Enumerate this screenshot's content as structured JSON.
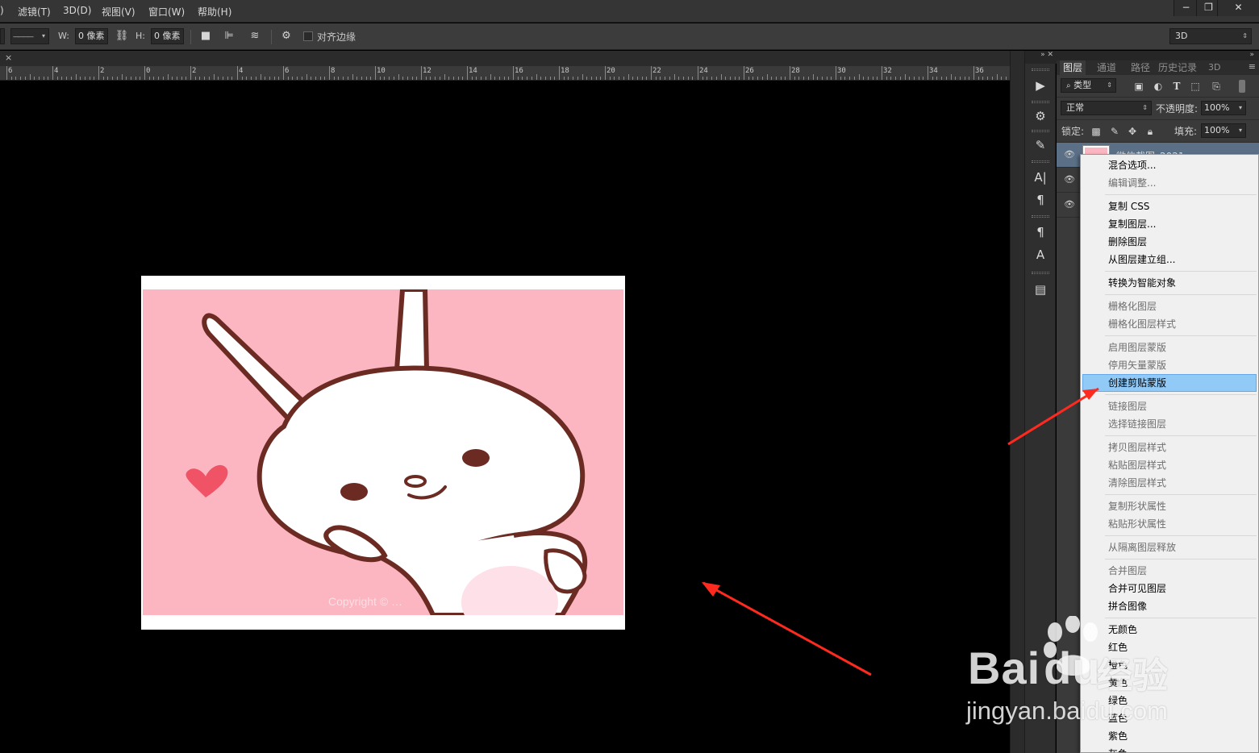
{
  "menubar": {
    "items": [
      "滤镜(T)",
      "3D(D)",
      "视图(V)",
      "窗口(W)",
      "帮助(H)"
    ],
    "partial_left": ")",
    "window_controls": [
      "−",
      "❐",
      "✕"
    ]
  },
  "options": {
    "stroke_style": "————",
    "w_label": "W:",
    "w_value": "0 像素",
    "link_icon": "link-icon",
    "h_label": "H:",
    "h_value": "0 像素",
    "align_edges_label": "对齐边缘",
    "workspace": "3D"
  },
  "doc": {
    "close": "×",
    "ruler_labels": [
      "6",
      "4",
      "2",
      "0",
      "2",
      "4",
      "6",
      "8",
      "10",
      "12",
      "14",
      "16",
      "18",
      "20",
      "22",
      "24",
      "26",
      "28",
      "30",
      "32",
      "34",
      "36"
    ]
  },
  "layers_panel": {
    "tabs": [
      "图层",
      "通道",
      "路径",
      "历史记录",
      "3D"
    ],
    "filter_kind": "类型",
    "blend_mode": "正常",
    "opacity_label": "不透明度:",
    "opacity_value": "100%",
    "lock_label": "锁定:",
    "fill_label": "填充:",
    "fill_value": "100%",
    "layer_name_partial": "微信截图_2021..."
  },
  "context_menu": {
    "groups": [
      [
        {
          "label": "混合选项...",
          "enabled": true
        },
        {
          "label": "编辑调整...",
          "enabled": false
        }
      ],
      [
        {
          "label": "复制 CSS",
          "enabled": true
        },
        {
          "label": "复制图层...",
          "enabled": true
        },
        {
          "label": "删除图层",
          "enabled": true
        },
        {
          "label": "从图层建立组...",
          "enabled": true
        }
      ],
      [
        {
          "label": "转换为智能对象",
          "enabled": true
        }
      ],
      [
        {
          "label": "栅格化图层",
          "enabled": false
        },
        {
          "label": "栅格化图层样式",
          "enabled": false
        }
      ],
      [
        {
          "label": "启用图层蒙版",
          "enabled": false
        },
        {
          "label": "停用矢量蒙版",
          "enabled": false
        },
        {
          "label": "创建剪贴蒙版",
          "enabled": true,
          "highlighted": true
        }
      ],
      [
        {
          "label": "链接图层",
          "enabled": false
        },
        {
          "label": "选择链接图层",
          "enabled": false
        }
      ],
      [
        {
          "label": "拷贝图层样式",
          "enabled": false
        },
        {
          "label": "粘贴图层样式",
          "enabled": false
        },
        {
          "label": "清除图层样式",
          "enabled": false
        }
      ],
      [
        {
          "label": "复制形状属性",
          "enabled": false
        },
        {
          "label": "粘贴形状属性",
          "enabled": false
        }
      ],
      [
        {
          "label": "从隔离图层释放",
          "enabled": false
        }
      ],
      [
        {
          "label": "合并图层",
          "enabled": false
        },
        {
          "label": "合并可见图层",
          "enabled": true
        },
        {
          "label": "拼合图像",
          "enabled": true
        }
      ],
      [
        {
          "label": "无颜色",
          "enabled": true
        },
        {
          "label": "红色",
          "enabled": true
        },
        {
          "label": "橙色",
          "enabled": true
        },
        {
          "label": "黄色",
          "enabled": true
        },
        {
          "label": "绿色",
          "enabled": true
        },
        {
          "label": "蓝色",
          "enabled": true
        },
        {
          "label": "紫色",
          "enabled": true
        },
        {
          "label": "灰色",
          "enabled": true
        }
      ]
    ]
  },
  "watermark": {
    "main": "Bai",
    "du": "du",
    "cn": "经验",
    "sub": "jingyan.baidu.com"
  },
  "image": {
    "embedded_text": "Copyright © …"
  },
  "colors": {
    "accent_highlight": "#91c9f7",
    "annotation_arrow": "#ff2a1f",
    "image_bg": "#fbb6c2"
  }
}
